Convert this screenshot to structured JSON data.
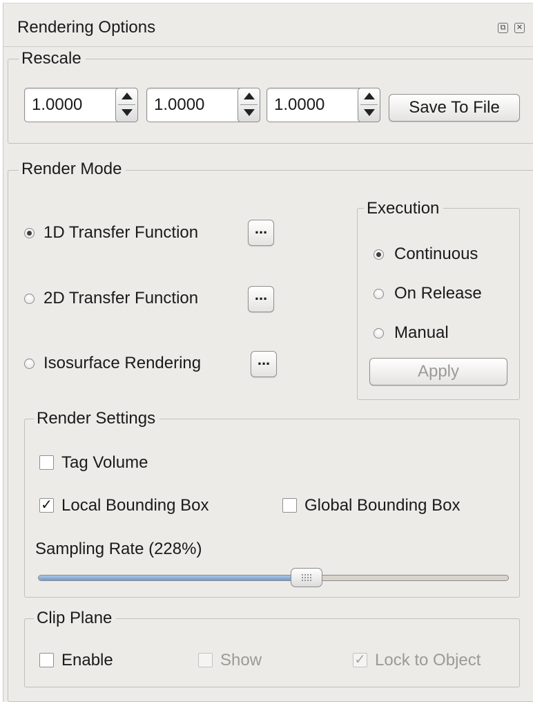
{
  "window": {
    "title": "Rendering Options",
    "icons": [
      "float-icon",
      "close-icon"
    ]
  },
  "rescale": {
    "legend": "Rescale",
    "values": [
      "1.0000",
      "1.0000",
      "1.0000"
    ],
    "save_label": "Save To File"
  },
  "render_mode": {
    "legend": "Render Mode",
    "options": [
      {
        "label": "1D Transfer Function",
        "selected": true,
        "button": "..."
      },
      {
        "label": "2D Transfer Function",
        "selected": false,
        "button": "..."
      },
      {
        "label": "Isosurface Rendering",
        "selected": false,
        "button": "..."
      }
    ],
    "execution": {
      "legend": "Execution",
      "options": [
        {
          "label": "Continuous",
          "selected": true
        },
        {
          "label": "On Release",
          "selected": false
        },
        {
          "label": "Manual",
          "selected": false
        }
      ],
      "apply_label": "Apply"
    }
  },
  "render_settings": {
    "legend": "Render Settings",
    "tag_volume": {
      "label": "Tag Volume",
      "checked": false
    },
    "local_bbox": {
      "label": "Local Bounding Box",
      "checked": true
    },
    "global_bbox": {
      "label": "Global Bounding Box",
      "checked": false
    },
    "sampling_label": "Sampling Rate (228%)",
    "sampling_fraction": 0.57
  },
  "clip_plane": {
    "legend": "Clip Plane",
    "enable": {
      "label": "Enable",
      "checked": false
    },
    "show": {
      "label": "Show",
      "checked": false,
      "disabled": true
    },
    "lock": {
      "label": "Lock to Object",
      "checked": true,
      "disabled": true
    }
  }
}
